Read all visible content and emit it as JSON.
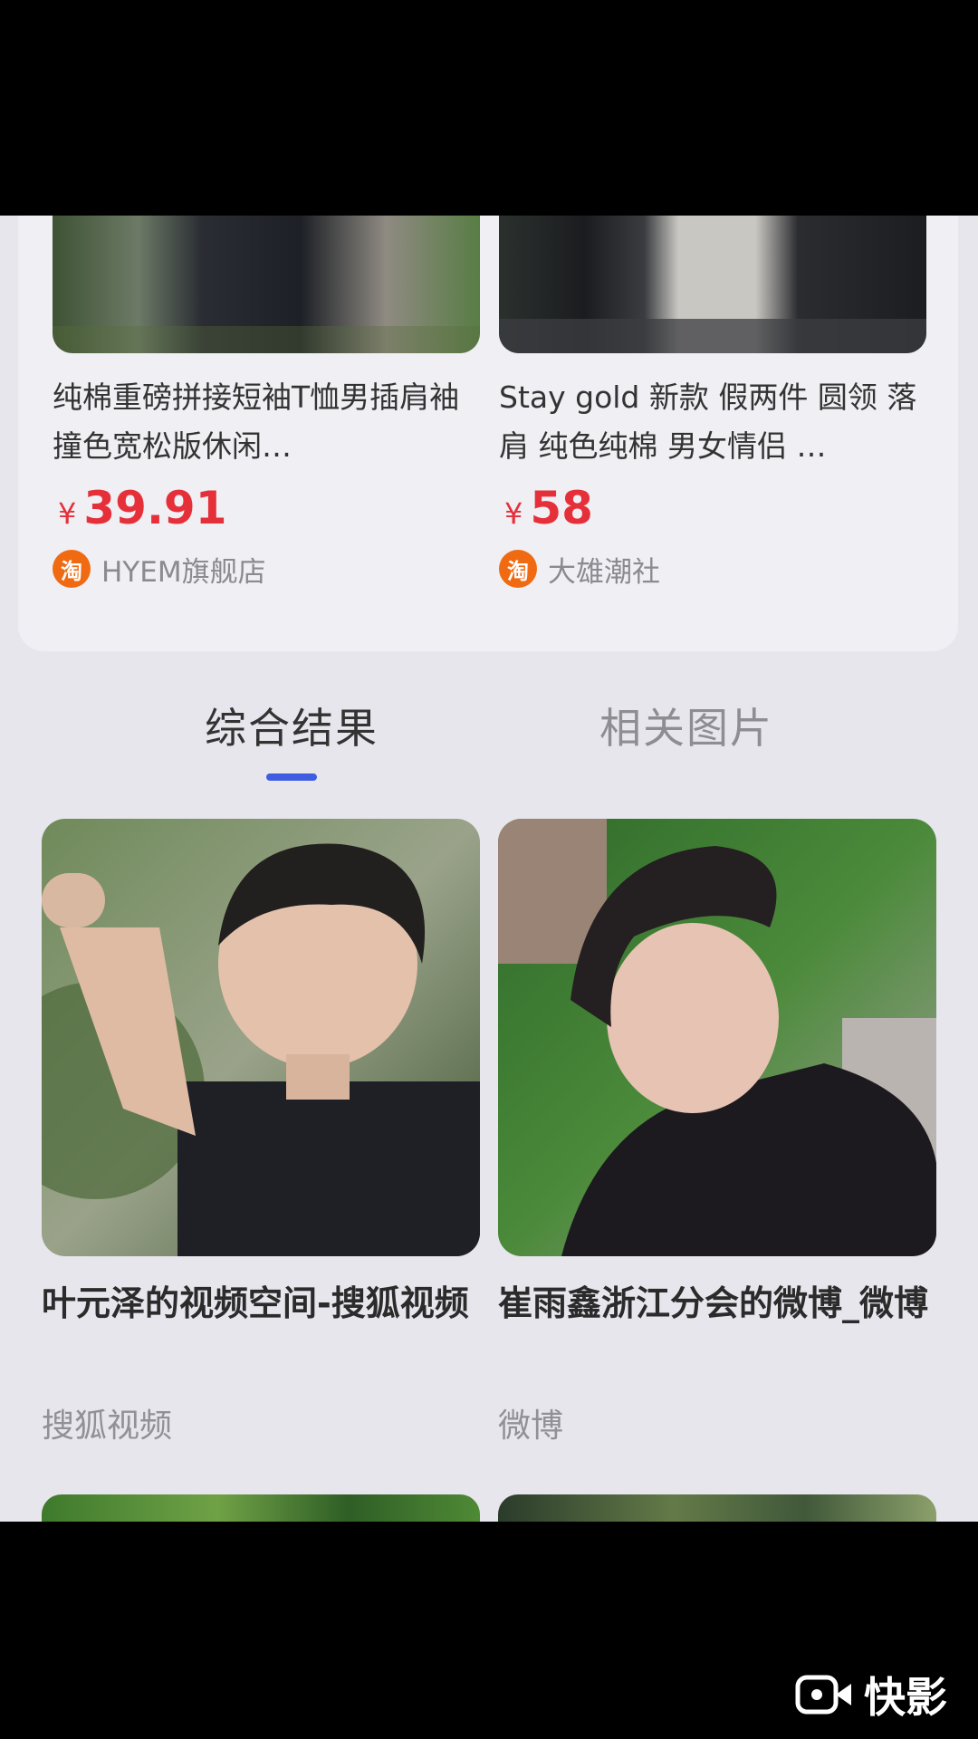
{
  "products": [
    {
      "title": "纯棉重磅拼接短袖T恤男插肩袖撞色宽松版休闲…",
      "currency": "¥",
      "price": "39.91",
      "shop_badge": "淘",
      "shop": "HYEM旗舰店"
    },
    {
      "title": "Stay gold 新款 假两件 圆领 落肩 纯色纯棉 男女情侣 …",
      "currency": "¥",
      "price": "58",
      "shop_badge": "淘",
      "shop": "大雄潮社"
    }
  ],
  "tabs": {
    "active": "综合结果",
    "inactive": "相关图片"
  },
  "results": [
    {
      "title": "叶元泽的视频空间-搜狐视频",
      "source": "搜狐视频"
    },
    {
      "title": "崔雨鑫浙江分会的微博_微博",
      "source": "微博"
    }
  ],
  "watermark": {
    "text": "快影",
    "icon": "kuaiying-camera-icon"
  },
  "colors": {
    "price": "#e5303a",
    "tab_accent": "#3f5de0",
    "taobao_badge": "#f06a12"
  }
}
